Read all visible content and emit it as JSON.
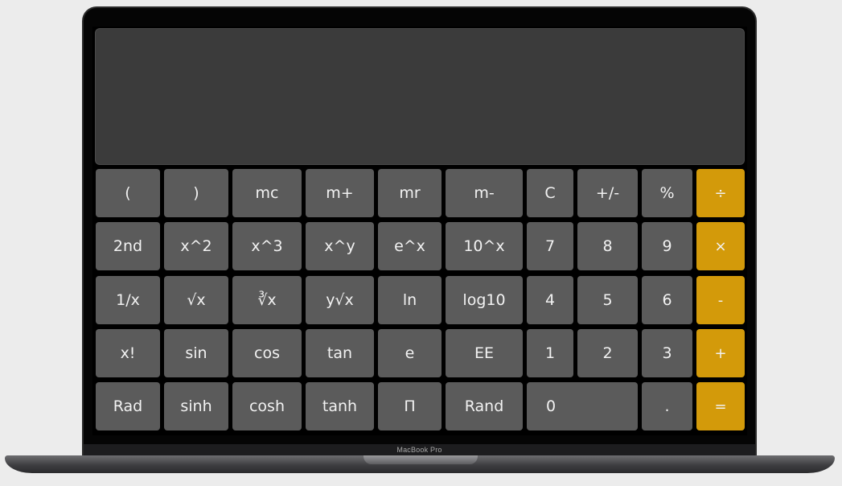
{
  "device": {
    "label": "MacBook Pro"
  },
  "calculator": {
    "display": {
      "value": ""
    },
    "keys": [
      [
        {
          "name": "open-paren-button",
          "label": "("
        },
        {
          "name": "close-paren-button",
          "label": ")"
        },
        {
          "name": "memory-clear-button",
          "label": "mc"
        },
        {
          "name": "memory-add-button",
          "label": "m+"
        },
        {
          "name": "memory-recall-button",
          "label": "mr"
        },
        {
          "name": "memory-subtract-button",
          "label": "m-"
        },
        {
          "name": "clear-button",
          "label": "C"
        },
        {
          "name": "sign-toggle-button",
          "label": "+/-"
        },
        {
          "name": "percent-button",
          "label": "%"
        },
        {
          "name": "divide-button",
          "label": "÷",
          "op": true
        }
      ],
      [
        {
          "name": "second-function-button",
          "label": "2nd"
        },
        {
          "name": "square-button",
          "label": "x^2"
        },
        {
          "name": "cube-button",
          "label": "x^3"
        },
        {
          "name": "power-button",
          "label": "x^y"
        },
        {
          "name": "exp-button",
          "label": "e^x"
        },
        {
          "name": "ten-power-button",
          "label": "10^x"
        },
        {
          "name": "digit-7-button",
          "label": "7"
        },
        {
          "name": "digit-8-button",
          "label": "8"
        },
        {
          "name": "digit-9-button",
          "label": "9"
        },
        {
          "name": "multiply-button",
          "label": "×",
          "op": true
        }
      ],
      [
        {
          "name": "reciprocal-button",
          "label": "1/x"
        },
        {
          "name": "square-root-button",
          "label": "√x"
        },
        {
          "name": "cube-root-button",
          "label": "∛x"
        },
        {
          "name": "nth-root-button",
          "label": "y√x"
        },
        {
          "name": "ln-button",
          "label": "ln"
        },
        {
          "name": "log10-button",
          "label": "log10"
        },
        {
          "name": "digit-4-button",
          "label": "4"
        },
        {
          "name": "digit-5-button",
          "label": "5"
        },
        {
          "name": "digit-6-button",
          "label": "6"
        },
        {
          "name": "subtract-button",
          "label": "-",
          "op": true
        }
      ],
      [
        {
          "name": "factorial-button",
          "label": "x!"
        },
        {
          "name": "sin-button",
          "label": "sin"
        },
        {
          "name": "cos-button",
          "label": "cos"
        },
        {
          "name": "tan-button",
          "label": "tan"
        },
        {
          "name": "euler-button",
          "label": "e"
        },
        {
          "name": "ee-button",
          "label": "EE"
        },
        {
          "name": "digit-1-button",
          "label": "1"
        },
        {
          "name": "digit-2-button",
          "label": "2"
        },
        {
          "name": "digit-3-button",
          "label": "3"
        },
        {
          "name": "add-button",
          "label": "+",
          "op": true
        }
      ],
      [
        {
          "name": "rad-button",
          "label": "Rad"
        },
        {
          "name": "sinh-button",
          "label": "sinh"
        },
        {
          "name": "cosh-button",
          "label": "cosh"
        },
        {
          "name": "tanh-button",
          "label": "tanh"
        },
        {
          "name": "pi-button",
          "label": "Π"
        },
        {
          "name": "rand-button",
          "label": "Rand"
        },
        {
          "name": "digit-0-button",
          "label": "0",
          "zero": true
        },
        {
          "name": "decimal-button",
          "label": "."
        },
        {
          "name": "equals-button",
          "label": "=",
          "op": true
        }
      ]
    ]
  }
}
